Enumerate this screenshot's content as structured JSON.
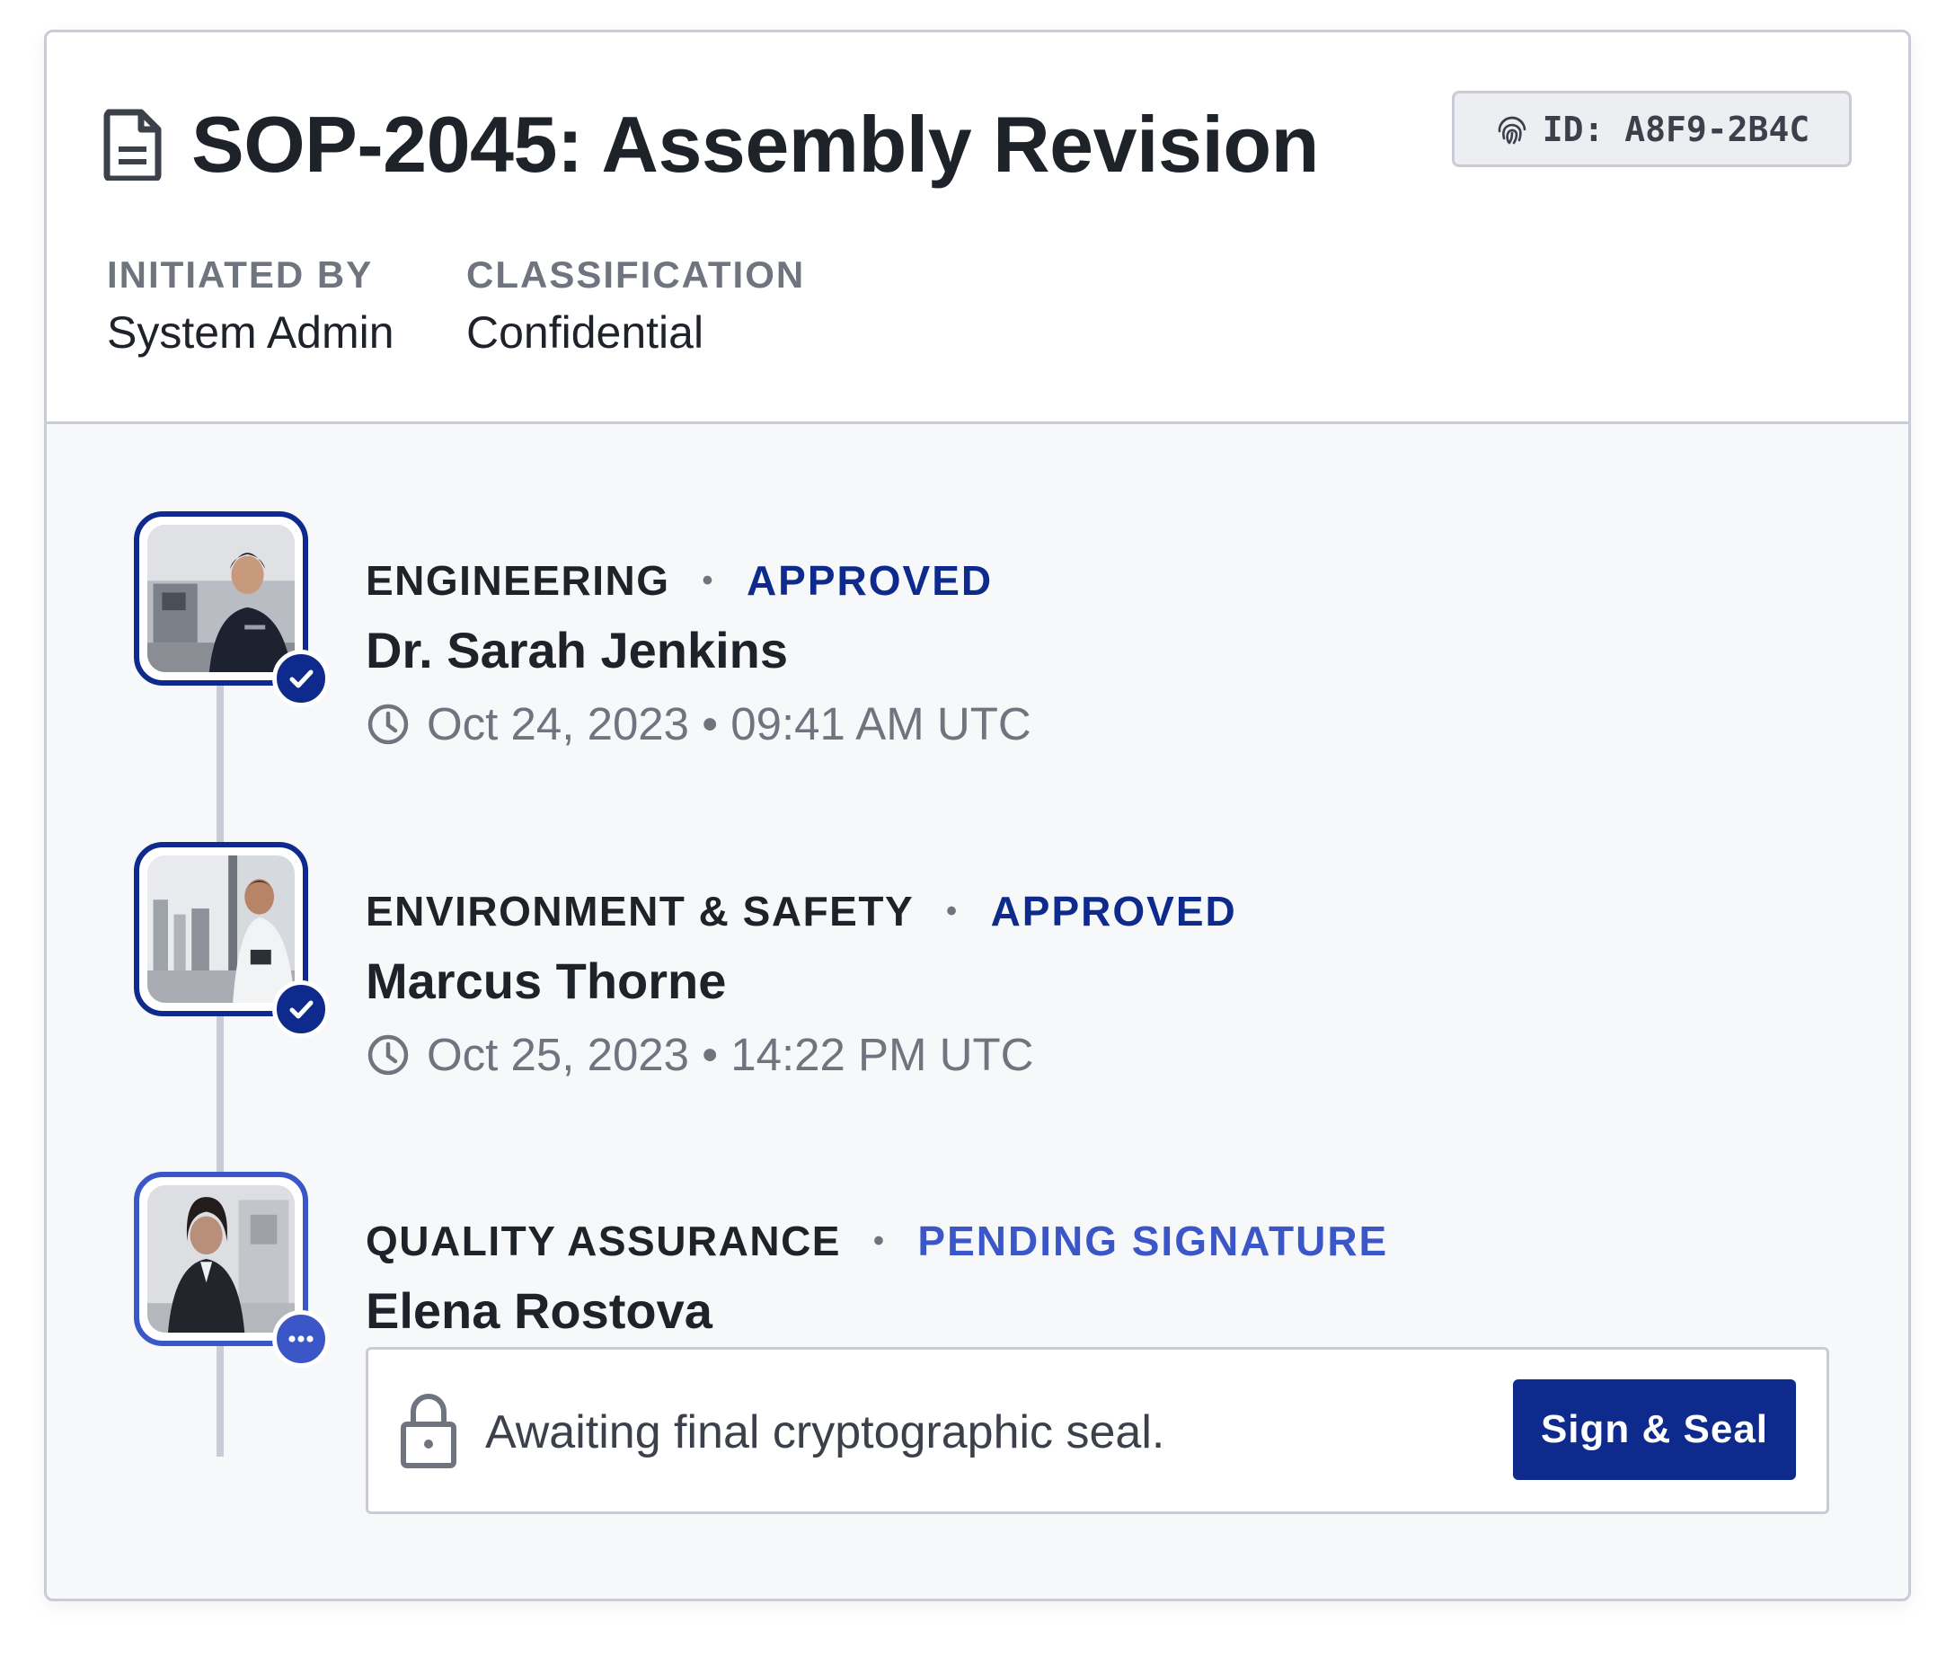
{
  "document": {
    "title": "SOP-2045: Assembly Revision",
    "id_label": "ID: A8F9-2B4C",
    "initiated_by_label": "INITIATED BY",
    "initiated_by_value": "System Admin",
    "classification_label": "CLASSIFICATION",
    "classification_value": "Confidential"
  },
  "approvals": [
    {
      "department": "ENGINEERING",
      "status": "APPROVED",
      "name": "Dr. Sarah Jenkins",
      "timestamp": "Oct 24, 2023 • 09:41 AM UTC",
      "status_icon": "check-icon"
    },
    {
      "department": "ENVIRONMENT & SAFETY",
      "status": "APPROVED",
      "name": "Marcus Thorne",
      "timestamp": "Oct 25, 2023 • 14:22 PM UTC",
      "status_icon": "check-icon"
    },
    {
      "department": "QUALITY ASSURANCE",
      "status": "PENDING SIGNATURE",
      "name": "Elena Rostova",
      "status_icon": "more-dots-icon"
    }
  ],
  "seal": {
    "message": "Awaiting final cryptographic seal.",
    "button_label": "Sign & Seal",
    "icon": "lock-icon"
  },
  "colors": {
    "approved": "#0d2a8c",
    "pending": "#3b57c7",
    "border": "#c9cbd6",
    "muted_text": "#70747f"
  }
}
